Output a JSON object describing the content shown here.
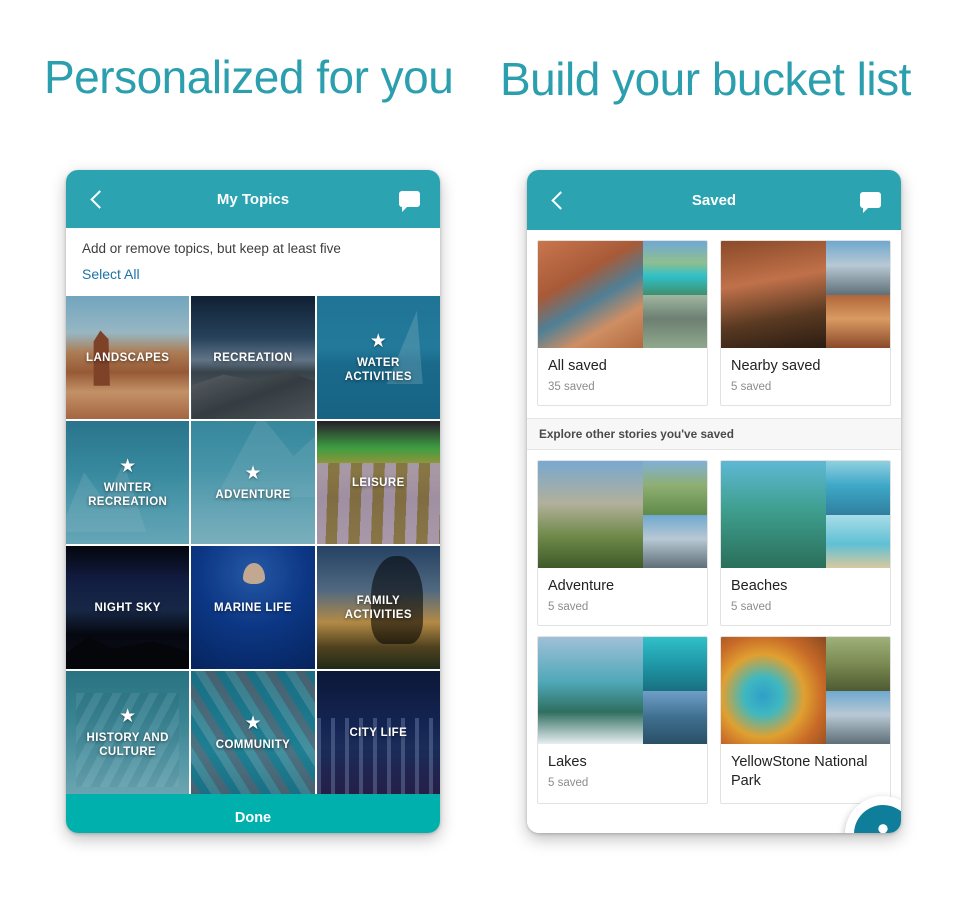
{
  "headings": {
    "left": "Personalized for you",
    "right": "Build your bucket list"
  },
  "colors": {
    "heading": "#2b9fae",
    "appbar": "#2ba3b0",
    "done_button": "#00b0ad",
    "bottom_nav": "#0e7e9b",
    "link": "#1b73a6"
  },
  "left_phone": {
    "appbar": {
      "back_icon": "back-chevron-icon",
      "title": "My Topics",
      "chat_icon": "chat-bubble-icon"
    },
    "subheader": {
      "hint": "Add or remove topics, but keep at least five",
      "select_all": "Select All"
    },
    "topics": [
      {
        "label": "LANDSCAPES",
        "selected": false,
        "art": "art-landscapes"
      },
      {
        "label": "RECREATION",
        "selected": false,
        "art": "art-recreation"
      },
      {
        "label": "WATER\nACTIVITIES",
        "selected": true,
        "art": "art-water"
      },
      {
        "label": "WINTER\nRECREATION",
        "selected": true,
        "art": "art-winter"
      },
      {
        "label": "ADVENTURE",
        "selected": true,
        "art": "art-adventure"
      },
      {
        "label": "LEISURE",
        "selected": false,
        "art": "art-leisure"
      },
      {
        "label": "NIGHT SKY",
        "selected": false,
        "art": "art-nightsky"
      },
      {
        "label": "MARINE LIFE",
        "selected": false,
        "art": "art-marine"
      },
      {
        "label": "FAMILY\nACTIVITIES",
        "selected": false,
        "art": "art-family"
      },
      {
        "label": "HISTORY AND\nCULTURE",
        "selected": true,
        "art": "art-history"
      },
      {
        "label": "COMMUNITY",
        "selected": true,
        "art": "art-community"
      },
      {
        "label": "CITY LIFE",
        "selected": false,
        "art": "art-citylife"
      }
    ],
    "star_glyph": "★",
    "done_label": "Done"
  },
  "right_phone": {
    "appbar": {
      "back_icon": "back-chevron-icon",
      "title": "Saved",
      "chat_icon": "chat-bubble-icon"
    },
    "top_cards": [
      {
        "title": "All saved",
        "count": "35 saved",
        "thumbs": [
          "t-canyon",
          "t-lake",
          "t-arch"
        ]
      },
      {
        "title": "Nearby saved",
        "count": "5 saved",
        "thumbs": [
          "t-tent",
          "t-mtn",
          "t-desert"
        ]
      }
    ],
    "explore_label": "Explore other stories you've saved",
    "story_cards": [
      {
        "title": "Adventure",
        "count": "5 saved",
        "thumbs": [
          "t-dolomite",
          "t-valley",
          "t-mtn"
        ]
      },
      {
        "title": "Beaches",
        "count": "5 saved",
        "thumbs": [
          "t-palm",
          "t-sea",
          "t-beach"
        ]
      },
      {
        "title": "Lakes",
        "count": "5 saved",
        "thumbs": [
          "t-banff",
          "t-turq",
          "t-coast"
        ]
      },
      {
        "title": "YellowStone National Park",
        "count": "",
        "thumbs": [
          "t-spring",
          "t-bison",
          "t-mtn"
        ]
      }
    ],
    "bottom_nav": [
      {
        "icon": "globe-icon",
        "name": "nav-explore"
      },
      {
        "icon": "navigate-icon",
        "name": "nav-nearby"
      },
      {
        "icon": "search-icon",
        "name": "nav-search"
      }
    ],
    "fab": {
      "icon": "profile-icon"
    }
  }
}
